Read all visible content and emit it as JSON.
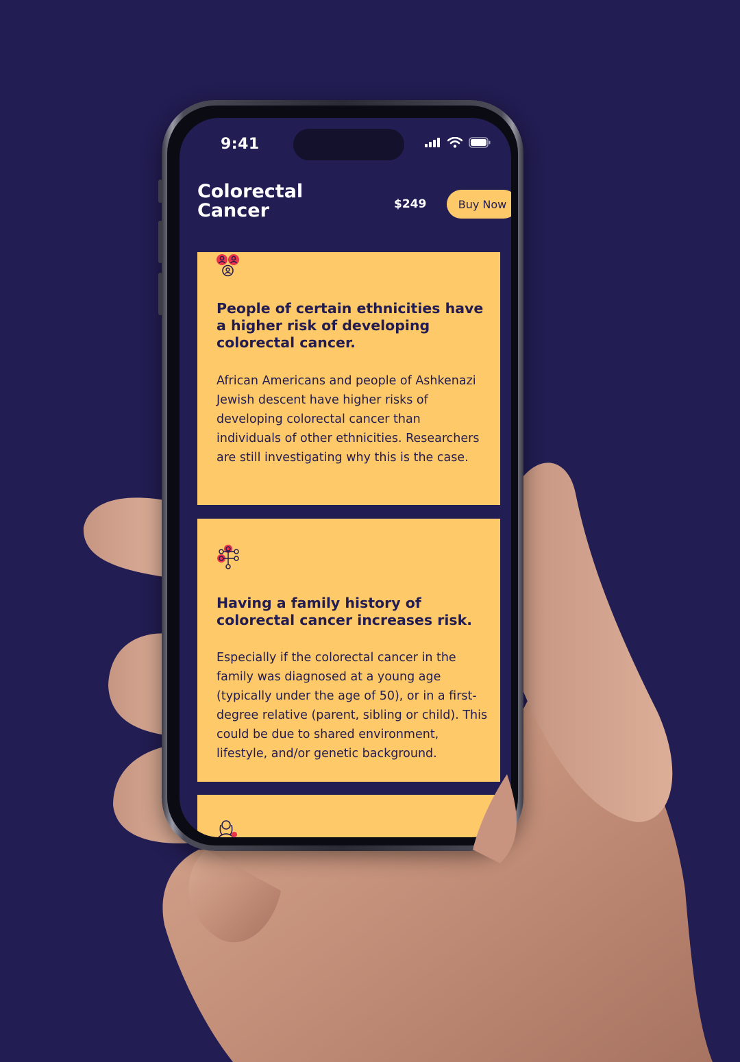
{
  "status_bar": {
    "time": "9:41"
  },
  "header": {
    "title": "Colorectal Cancer",
    "price": "$249",
    "buy_label": "Buy Now"
  },
  "cards": [
    {
      "icon": "people-group-icon",
      "title": "People of certain ethnicities have a higher risk of developing colorectal cancer.",
      "body": "African Americans and people of Ashkenazi Jewish descent have higher risks of developing colorectal cancer than individuals of other ethnicities. Researchers are still investigating why this is the case."
    },
    {
      "icon": "family-tree-icon",
      "title": "Having a family history of colorectal cancer increases risk.",
      "body": "Especially if the colorectal cancer in the family was diagnosed at a young age (typically under the age of 50), or in a first-degree relative (parent, sibling or child). This could be due to shared environment, lifestyle, and/or genetic background."
    },
    {
      "icon": "person-icon"
    }
  ],
  "colors": {
    "background": "#221d52",
    "card": "#fec969",
    "text_dark": "#231c50",
    "accent_red": "#e8334a"
  }
}
